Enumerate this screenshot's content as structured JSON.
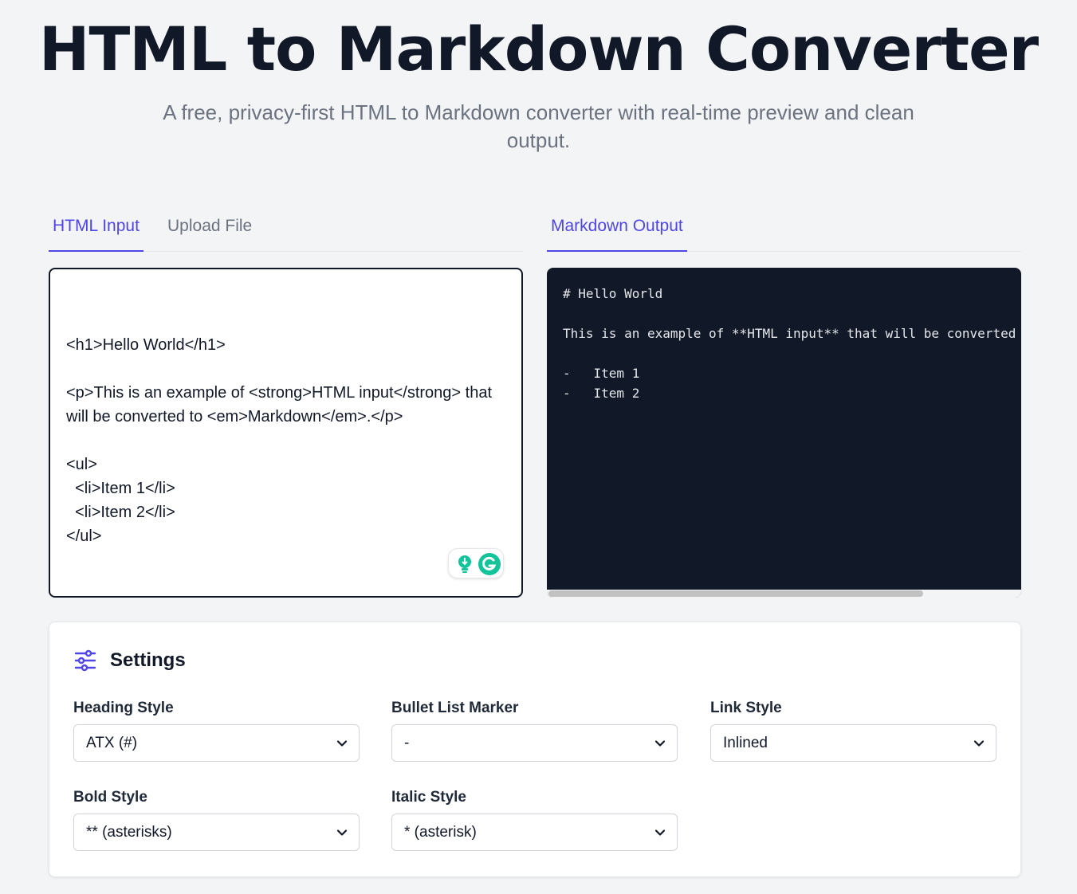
{
  "header": {
    "title": "HTML to Markdown Converter",
    "subtitle": "A free, privacy-first HTML to Markdown converter with real-time preview and clean output."
  },
  "input_panel": {
    "tabs": [
      {
        "label": "HTML Input",
        "active": true
      },
      {
        "label": "Upload File",
        "active": false
      }
    ],
    "content": "<h1>Hello World</h1>\n\n<p>This is an example of <strong>HTML input</strong> that will be converted to <em>Markdown</em>.</p>\n\n<ul>\n  <li>Item 1</li>\n  <li>Item 2</li>\n</ul>"
  },
  "output_panel": {
    "tab": {
      "label": "Markdown Output",
      "active": true
    },
    "content": "# Hello World\n\nThis is an example of **HTML input** that will be converted to *Markdown*.\n\n-   Item 1\n-   Item 2"
  },
  "settings": {
    "title": "Settings",
    "fields": {
      "heading_style": {
        "label": "Heading Style",
        "value": "ATX (#)"
      },
      "bullet_marker": {
        "label": "Bullet List Marker",
        "value": "-"
      },
      "link_style": {
        "label": "Link Style",
        "value": "Inlined"
      },
      "bold_style": {
        "label": "Bold Style",
        "value": "** (asterisks)"
      },
      "italic_style": {
        "label": "Italic Style",
        "value": "* (asterisk)"
      }
    }
  },
  "colors": {
    "accent": "#4f46e5",
    "output_bg": "#111827",
    "page_bg": "#f3f4f6",
    "grammarly": "#15c39a"
  },
  "icons": {
    "settings": "sliders-icon",
    "select": "chevron-down-icon",
    "grammarly": "grammarly-icon"
  }
}
